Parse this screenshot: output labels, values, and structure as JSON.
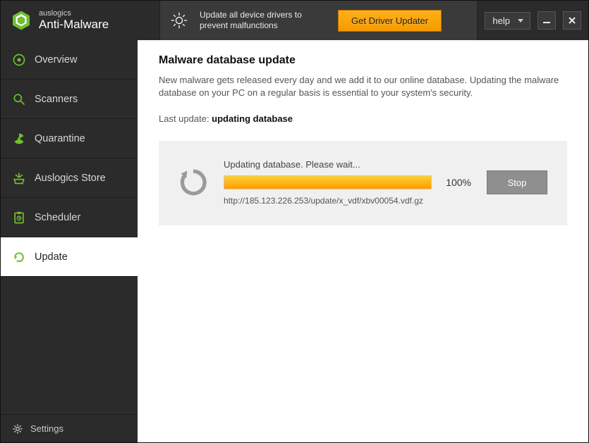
{
  "brand": {
    "small": "auslogics",
    "big": "Anti-Malware"
  },
  "promo": {
    "text": "Update all device drivers to prevent malfunctions",
    "button": "Get Driver Updater"
  },
  "header": {
    "help_label": "help"
  },
  "sidebar": {
    "items": [
      {
        "label": "Overview"
      },
      {
        "label": "Scanners"
      },
      {
        "label": "Quarantine"
      },
      {
        "label": "Auslogics Store"
      },
      {
        "label": "Scheduler"
      },
      {
        "label": "Update"
      }
    ],
    "settings_label": "Settings"
  },
  "main": {
    "title": "Malware database update",
    "description": "New malware gets released every day and we add it to our online database. Updating the malware database on your PC on a regular basis is essential to your system's security.",
    "lastupdate_prefix": "Last update: ",
    "lastupdate_value": "updating database",
    "progress": {
      "status": "Updating database. Please wait...",
      "percent_text": "100%",
      "percent_width": "100%",
      "url": "http://185.123.226.253/update/x_vdf/xbv00054.vdf.gz",
      "stop_label": "Stop"
    }
  }
}
